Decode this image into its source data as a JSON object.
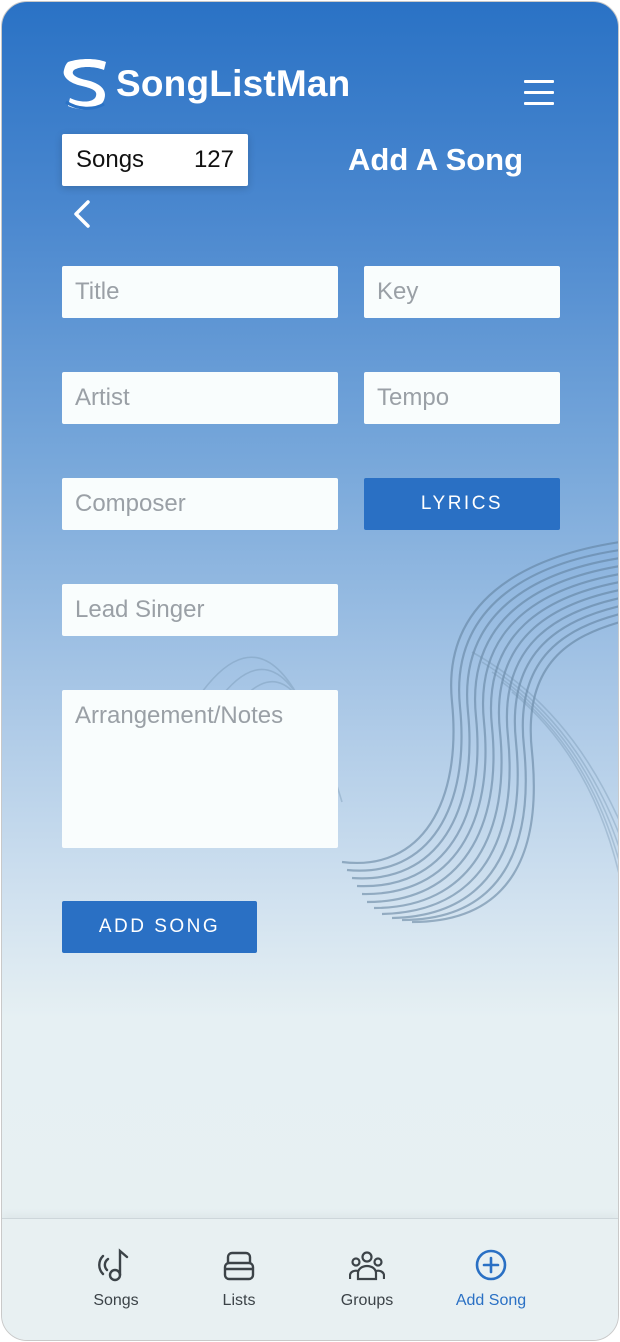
{
  "app": {
    "name": "SongListMan",
    "brand_color": "#2a70c4"
  },
  "header": {
    "menu_icon": "hamburger-menu-icon",
    "songs_badge": {
      "label": "Songs",
      "count": "127"
    },
    "page_title": "Add A Song",
    "back_icon": "chevron-left-icon"
  },
  "form": {
    "title_placeholder": "Title",
    "key_placeholder": "Key",
    "artist_placeholder": "Artist",
    "tempo_placeholder": "Tempo",
    "composer_placeholder": "Composer",
    "lyrics_label": "LYRICS",
    "lead_singer_placeholder": "Lead Singer",
    "notes_placeholder": "Arrangement/Notes",
    "submit_label": "ADD SONG"
  },
  "bottom_nav": {
    "items": [
      {
        "label": "Songs",
        "icon": "music-note-icon",
        "active": false
      },
      {
        "label": "Lists",
        "icon": "stack-icon",
        "active": false
      },
      {
        "label": "Groups",
        "icon": "group-people-icon",
        "active": false
      },
      {
        "label": "Add Song",
        "icon": "add-circle-icon",
        "active": true
      }
    ]
  }
}
